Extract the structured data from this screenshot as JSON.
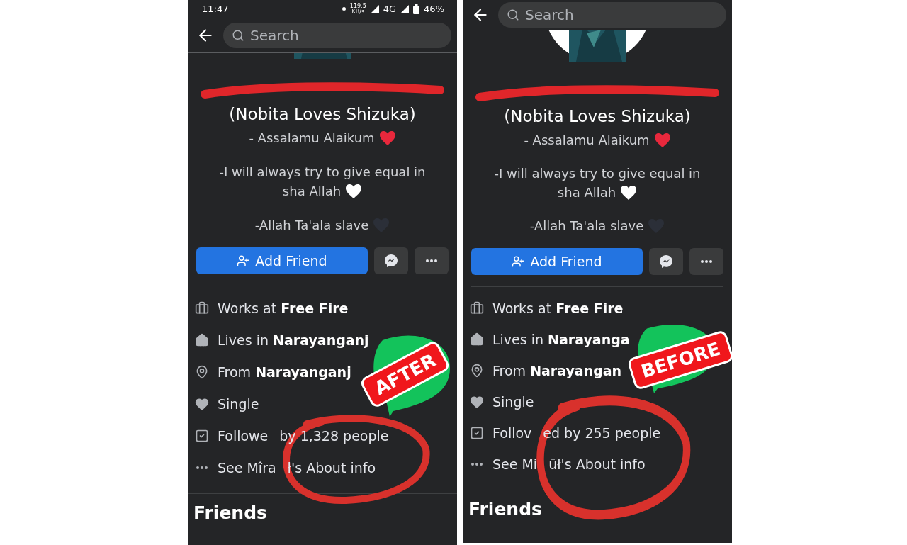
{
  "panels": [
    {
      "status_bar": {
        "time": "11:47",
        "speed": "119.5",
        "speed_unit": "KB/s",
        "network": "4G",
        "battery": "46%"
      },
      "search": {
        "placeholder": "Search"
      },
      "nickname": "(Nobita Loves Shizuka)",
      "bio": [
        {
          "lines": [
            "- Assalamu Alaikum"
          ],
          "color": "#e8283c"
        },
        {
          "lines": [
            "-I will always try to give equal in",
            "sha Allah"
          ],
          "color": "#ffffff"
        },
        {
          "lines": [
            "-Allah Ta'ala slave"
          ],
          "color": "#2b2f38"
        }
      ],
      "actions": {
        "add_friend": "Add Friend"
      },
      "details": [
        {
          "kind": "work",
          "parts": [
            "Works at **Free Fire**"
          ]
        },
        {
          "kind": "home",
          "parts": [
            "Lives in **Narayanganj**"
          ]
        },
        {
          "kind": "from",
          "parts": [
            "From **Narayanganj**"
          ]
        },
        {
          "kind": "relationship",
          "parts": [
            "Single"
          ]
        },
        {
          "kind": "followers",
          "parts": [
            "Followe",
            "by 1,328 people"
          ]
        },
        {
          "kind": "more",
          "parts": [
            "See Mîra",
            "ł's About info"
          ]
        }
      ],
      "section_title": "Friends",
      "badge": "AFTER"
    },
    {
      "search": {
        "placeholder": "Search"
      },
      "nickname": "(Nobita Loves Shizuka)",
      "bio": [
        {
          "lines": [
            "- Assalamu Alaikum"
          ],
          "color": "#e8283c"
        },
        {
          "lines": [
            "-I will always try to give equal in",
            "sha Allah"
          ],
          "color": "#ffffff"
        },
        {
          "lines": [
            "-Allah Ta'ala slave"
          ],
          "color": "#2b2f38"
        }
      ],
      "actions": {
        "add_friend": "Add Friend"
      },
      "details": [
        {
          "kind": "work",
          "parts": [
            "Works at **Free Fire**"
          ]
        },
        {
          "kind": "home",
          "parts": [
            "Lives in **Narayanga**"
          ]
        },
        {
          "kind": "from",
          "parts": [
            "From **Narayangan**"
          ]
        },
        {
          "kind": "relationship",
          "parts": [
            "Single"
          ]
        },
        {
          "kind": "followers",
          "parts": [
            "Follov",
            "ed by 255 people"
          ]
        },
        {
          "kind": "more",
          "parts": [
            "See Mi",
            "ūł's About info"
          ]
        }
      ],
      "section_title": "Friends",
      "badge": "BEFORE"
    }
  ]
}
